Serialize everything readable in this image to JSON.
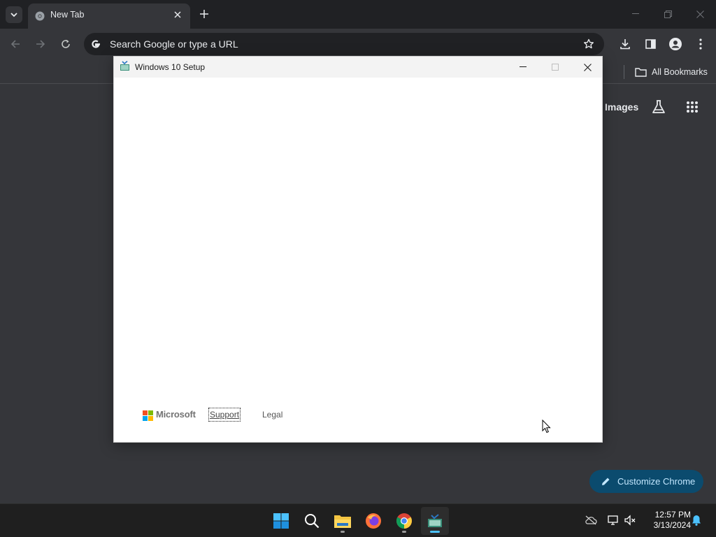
{
  "browser": {
    "tab_title": "New Tab",
    "omnibox_placeholder": "Search Google or type a URL",
    "bookmarks_label": "All Bookmarks",
    "images_link": "Images",
    "customize_label": "Customize Chrome"
  },
  "setup_window": {
    "title": "Windows 10 Setup",
    "footer": {
      "brand": "Microsoft",
      "support_label": "Support",
      "legal_label": "Legal"
    }
  },
  "taskbar": {
    "time": "12:57 PM",
    "date": "3/13/2024"
  },
  "colors": {
    "browser_bg": "#35363a",
    "tabstrip_bg": "#202124",
    "customize_bg": "#0b4b6e",
    "taskbar_bg": "#1f1f1f"
  }
}
